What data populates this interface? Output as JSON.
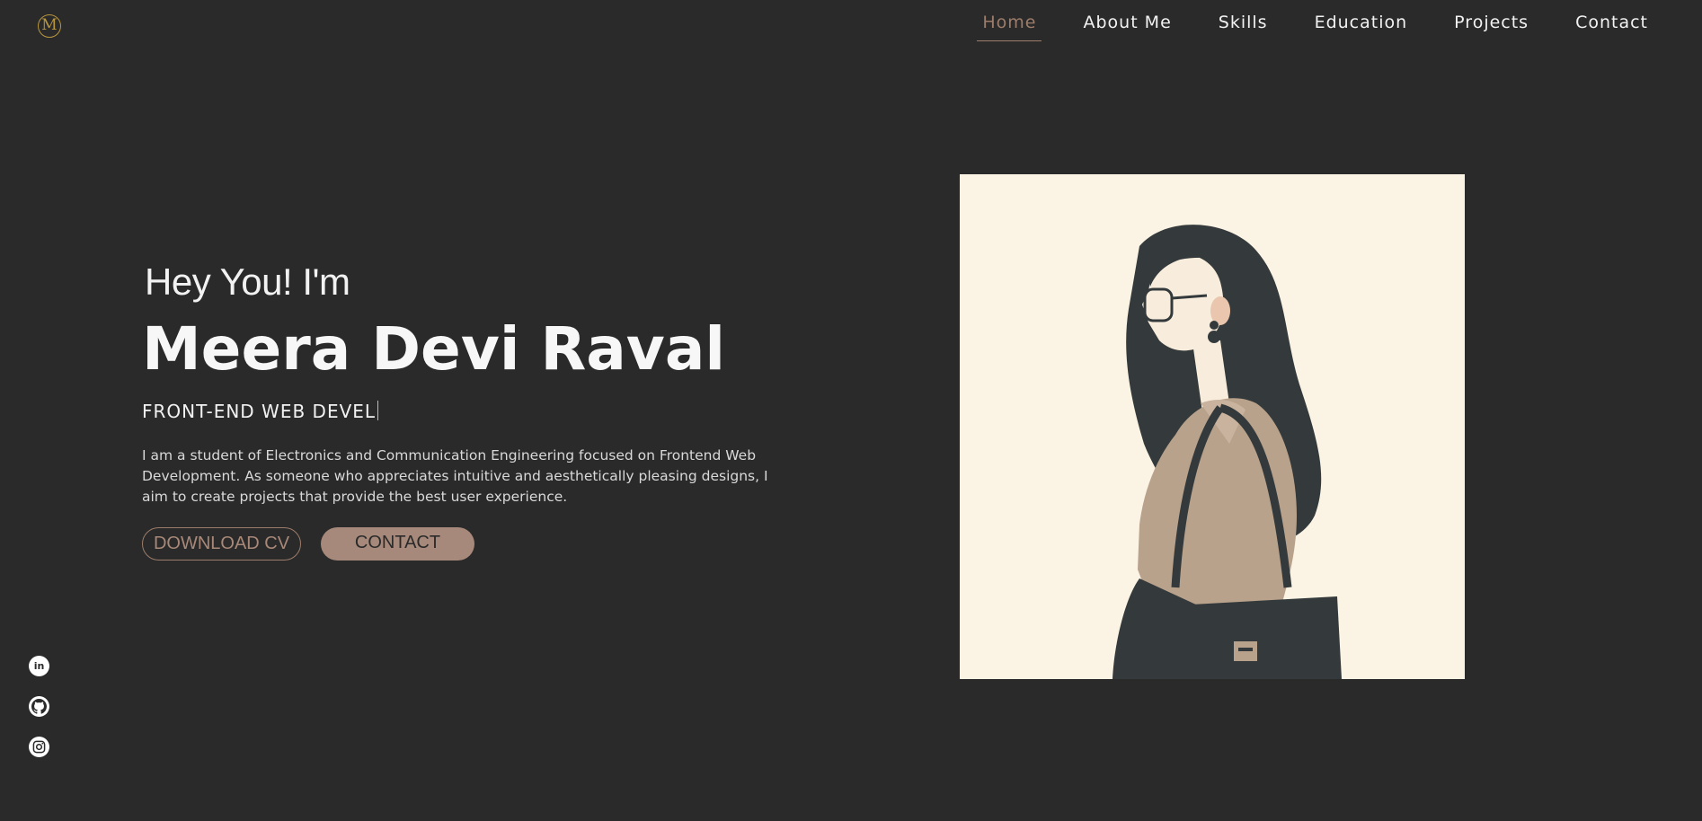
{
  "logo": {
    "letter": "M"
  },
  "nav": {
    "items": [
      {
        "label": "Home",
        "active": true
      },
      {
        "label": "About Me",
        "active": false
      },
      {
        "label": "Skills",
        "active": false
      },
      {
        "label": "Education",
        "active": false
      },
      {
        "label": "Projects",
        "active": false
      },
      {
        "label": "Contact",
        "active": false
      }
    ]
  },
  "hero": {
    "greeting": "Hey You! I'm",
    "name": "Meera Devi Raval",
    "role_typed": "FRONT-END WEB DEVEL",
    "intro": "I am a student of Electronics and Communication Engineering focused on Frontend Web Development. As someone who appreciates intuitive and aesthetically pleasing designs, I aim to create projects that provide the best user experience.",
    "buttons": {
      "download_cv": "DOWNLOAD CV",
      "contact": "CONTACT"
    }
  },
  "social": {
    "icons": [
      "linkedin-icon",
      "github-icon",
      "instagram-icon"
    ],
    "linkedin_glyph": "in"
  },
  "colors": {
    "background": "#2a2a2a",
    "accent": "#9c7c6a",
    "button_fill": "#a6897a",
    "logo_gold": "#b8963e",
    "portrait_bg": "#fbf3e4"
  }
}
